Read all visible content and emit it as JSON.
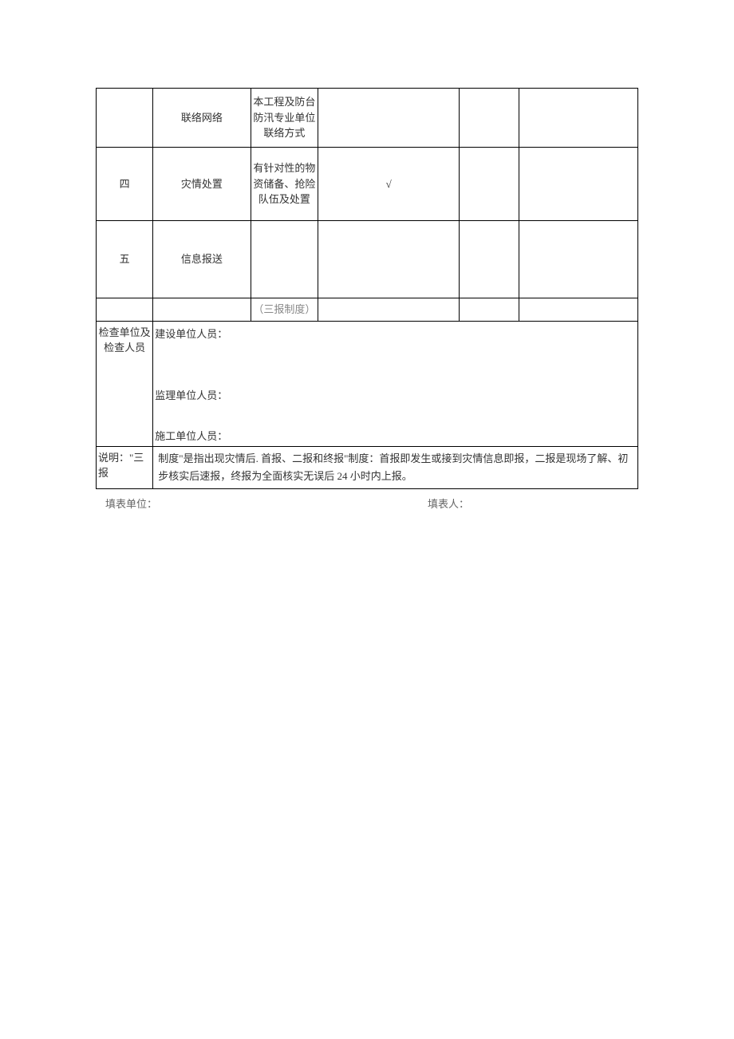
{
  "rows": {
    "r1": {
      "col2": "联络网络",
      "col3": "本工程及防台防汛专业单位联络方式"
    },
    "r2": {
      "col1": "四",
      "col2": "灾情处置",
      "col3": "有针对性的物资储备、抢险队伍及处置",
      "col4": "√"
    },
    "r3": {
      "col1": "五",
      "col2": "信息报送"
    },
    "r3b": {
      "col3": "（三报制度）"
    }
  },
  "personnel": {
    "label": "检查单位及检查人员",
    "line1": "建设单位人员：",
    "line2": "监理单位人员：",
    "line3": "施工单位人员："
  },
  "description": {
    "label": "说明：\"三报",
    "text_part1": "制度\"是指出现灾情后. 首报、二报和终报\"制度：首报即发生或接到灾情信息即报，二报是现场了解、初步核实后速报，终报为全面核实无误后 24 小时内上报。"
  },
  "footer": {
    "left": "填表单位：",
    "right": "填表人："
  }
}
